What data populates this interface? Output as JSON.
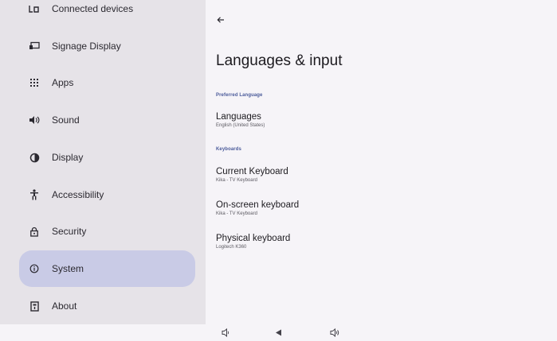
{
  "sidebar": {
    "items": [
      {
        "label": "Connected devices",
        "icon": "connected-devices-icon"
      },
      {
        "label": "Signage Display",
        "icon": "signage-display-icon"
      },
      {
        "label": "Apps",
        "icon": "apps-grid-icon"
      },
      {
        "label": "Sound",
        "icon": "sound-icon"
      },
      {
        "label": "Display",
        "icon": "display-icon"
      },
      {
        "label": "Accessibility",
        "icon": "accessibility-icon"
      },
      {
        "label": "Security",
        "icon": "lock-icon"
      },
      {
        "label": "System",
        "icon": "info-icon",
        "selected": true
      },
      {
        "label": "About",
        "icon": "about-icon"
      }
    ]
  },
  "main": {
    "title": "Languages & input",
    "sections": [
      {
        "header": "Preferred Language"
      },
      {
        "header": "Keyboards"
      }
    ],
    "preferences": [
      {
        "title": "Languages",
        "subtitle": "English (United States)"
      },
      {
        "title": "Current Keyboard",
        "subtitle": "Kika - TV Keyboard"
      },
      {
        "title": "On-screen keyboard",
        "subtitle": "Kika - TV Keyboard"
      },
      {
        "title": "Physical keyboard",
        "subtitle": "Logitech K360"
      }
    ]
  },
  "navbar": {
    "buttons": [
      "volume-down-icon",
      "back-icon",
      "volume-up-icon"
    ]
  },
  "colors": {
    "sidebar_bg": "#e6e3e8",
    "selected_bg": "#c9cbe6",
    "accent": "#4a5a9a",
    "content_bg": "#f6f4f8"
  }
}
